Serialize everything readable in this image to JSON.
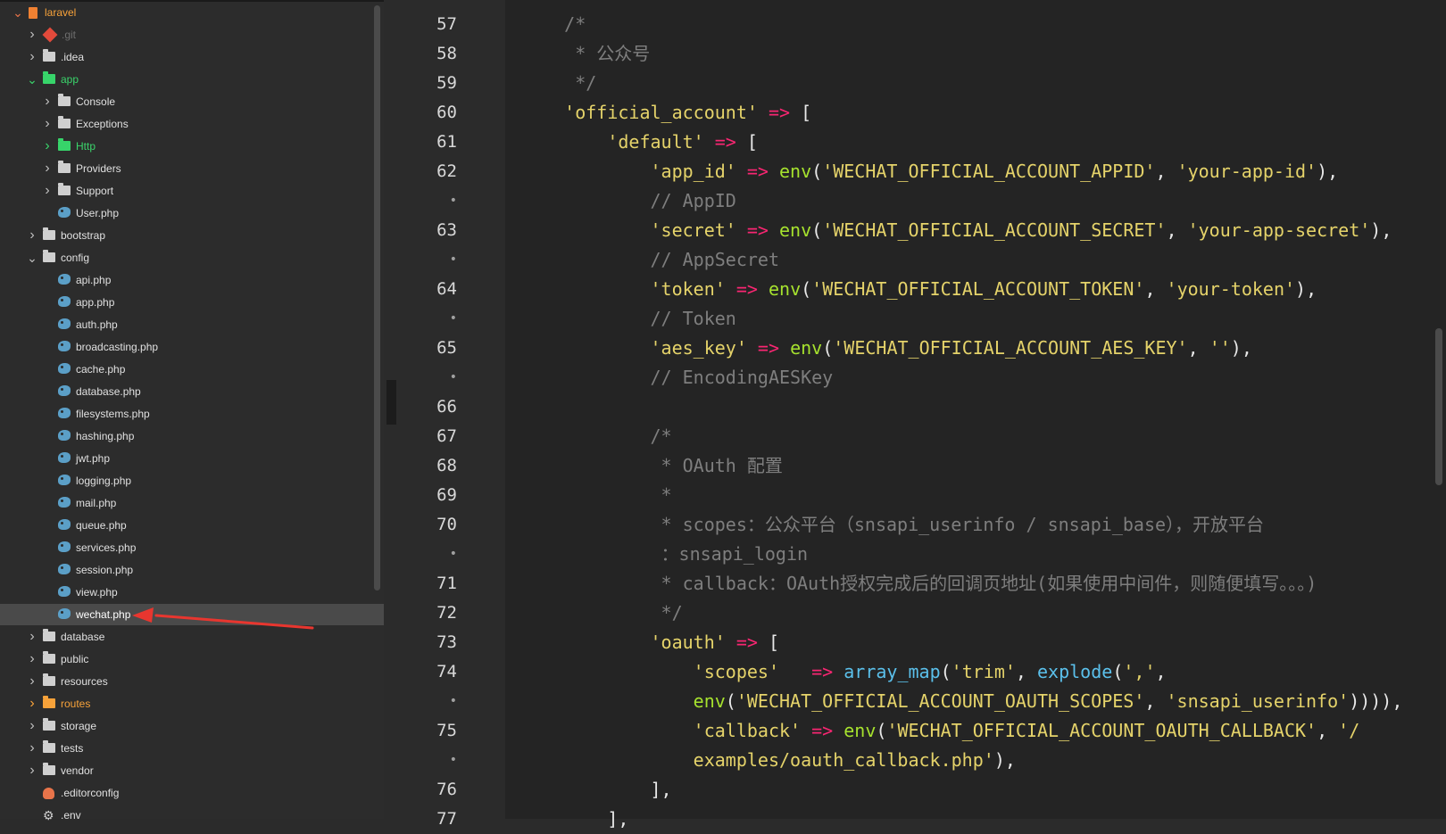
{
  "tree": [
    {
      "label": "laravel",
      "level": 0,
      "arrow": "open-red",
      "icon": "repo",
      "color": "orange"
    },
    {
      "label": ".git",
      "level": 1,
      "arrow": "closed",
      "icon": "git",
      "color": "gray"
    },
    {
      "label": ".idea",
      "level": 1,
      "arrow": "closed",
      "icon": "folder",
      "color": "normal"
    },
    {
      "label": "app",
      "level": 1,
      "arrow": "open",
      "icon": "folder-green",
      "color": "green"
    },
    {
      "label": "Console",
      "level": 2,
      "arrow": "closed",
      "icon": "folder",
      "color": "normal"
    },
    {
      "label": "Exceptions",
      "level": 2,
      "arrow": "closed",
      "icon": "folder",
      "color": "normal"
    },
    {
      "label": "Http",
      "level": 2,
      "arrow": "closed-green",
      "icon": "folder-green",
      "color": "green"
    },
    {
      "label": "Providers",
      "level": 2,
      "arrow": "closed",
      "icon": "folder",
      "color": "normal"
    },
    {
      "label": "Support",
      "level": 2,
      "arrow": "closed",
      "icon": "folder",
      "color": "normal"
    },
    {
      "label": "User.php",
      "level": 2,
      "arrow": "none",
      "icon": "php",
      "color": "normal"
    },
    {
      "label": "bootstrap",
      "level": 1,
      "arrow": "closed",
      "icon": "folder",
      "color": "normal"
    },
    {
      "label": "config",
      "level": 1,
      "arrow": "open-plain",
      "icon": "folder",
      "color": "normal"
    },
    {
      "label": "api.php",
      "level": 2,
      "arrow": "none",
      "icon": "php",
      "color": "normal"
    },
    {
      "label": "app.php",
      "level": 2,
      "arrow": "none",
      "icon": "php",
      "color": "normal"
    },
    {
      "label": "auth.php",
      "level": 2,
      "arrow": "none",
      "icon": "php",
      "color": "normal"
    },
    {
      "label": "broadcasting.php",
      "level": 2,
      "arrow": "none",
      "icon": "php",
      "color": "normal"
    },
    {
      "label": "cache.php",
      "level": 2,
      "arrow": "none",
      "icon": "php",
      "color": "normal"
    },
    {
      "label": "database.php",
      "level": 2,
      "arrow": "none",
      "icon": "php",
      "color": "normal"
    },
    {
      "label": "filesystems.php",
      "level": 2,
      "arrow": "none",
      "icon": "php",
      "color": "normal"
    },
    {
      "label": "hashing.php",
      "level": 2,
      "arrow": "none",
      "icon": "php",
      "color": "normal"
    },
    {
      "label": "jwt.php",
      "level": 2,
      "arrow": "none",
      "icon": "php",
      "color": "normal"
    },
    {
      "label": "logging.php",
      "level": 2,
      "arrow": "none",
      "icon": "php",
      "color": "normal"
    },
    {
      "label": "mail.php",
      "level": 2,
      "arrow": "none",
      "icon": "php",
      "color": "normal"
    },
    {
      "label": "queue.php",
      "level": 2,
      "arrow": "none",
      "icon": "php",
      "color": "normal"
    },
    {
      "label": "services.php",
      "level": 2,
      "arrow": "none",
      "icon": "php",
      "color": "normal"
    },
    {
      "label": "session.php",
      "level": 2,
      "arrow": "none",
      "icon": "php",
      "color": "normal"
    },
    {
      "label": "view.php",
      "level": 2,
      "arrow": "none",
      "icon": "php",
      "color": "normal"
    },
    {
      "label": "wechat.php",
      "level": 2,
      "arrow": "none",
      "icon": "php",
      "color": "white",
      "selected": true
    },
    {
      "label": "database",
      "level": 1,
      "arrow": "closed",
      "icon": "folder",
      "color": "normal"
    },
    {
      "label": "public",
      "level": 1,
      "arrow": "closed",
      "icon": "folder",
      "color": "normal"
    },
    {
      "label": "resources",
      "level": 1,
      "arrow": "closed",
      "icon": "folder",
      "color": "normal"
    },
    {
      "label": "routes",
      "level": 1,
      "arrow": "closed-orange",
      "icon": "folder-orange",
      "color": "orange"
    },
    {
      "label": "storage",
      "level": 1,
      "arrow": "closed",
      "icon": "folder",
      "color": "normal"
    },
    {
      "label": "tests",
      "level": 1,
      "arrow": "closed",
      "icon": "folder",
      "color": "normal"
    },
    {
      "label": "vendor",
      "level": 1,
      "arrow": "closed",
      "icon": "folder",
      "color": "normal"
    },
    {
      "label": ".editorconfig",
      "level": 1,
      "arrow": "none",
      "icon": "editorconfig",
      "color": "normal"
    },
    {
      "label": ".env",
      "level": 1,
      "arrow": "none",
      "icon": "gear",
      "color": "normal"
    }
  ],
  "gutter": [
    "57",
    "58",
    "59",
    "60",
    "61",
    "62",
    "•",
    "63",
    "•",
    "64",
    "•",
    "65",
    "•",
    "66",
    "67",
    "68",
    "69",
    "70",
    "•",
    "71",
    "72",
    "73",
    "74",
    "•",
    "75",
    "•",
    "76",
    "77"
  ],
  "code_lines": [
    [
      [
        "c",
        "    /*"
      ]
    ],
    [
      [
        "c",
        "     * 公众号"
      ]
    ],
    [
      [
        "c",
        "     */"
      ]
    ],
    [
      [
        "p",
        "    "
      ],
      [
        "s",
        "'official_account'"
      ],
      [
        "p",
        " "
      ],
      [
        "o",
        "=>"
      ],
      [
        "p",
        " ["
      ]
    ],
    [
      [
        "p",
        "        "
      ],
      [
        "s",
        "'default'"
      ],
      [
        "p",
        " "
      ],
      [
        "o",
        "=>"
      ],
      [
        "p",
        " ["
      ]
    ],
    [
      [
        "p",
        "            "
      ],
      [
        "s",
        "'app_id'"
      ],
      [
        "p",
        " "
      ],
      [
        "o",
        "=>"
      ],
      [
        "p",
        " "
      ],
      [
        "f",
        "env"
      ],
      [
        "p",
        "("
      ],
      [
        "s",
        "'WECHAT_OFFICIAL_ACCOUNT_APPID'"
      ],
      [
        "p",
        ", "
      ],
      [
        "s",
        "'your-app-id'"
      ],
      [
        "p",
        "),"
      ]
    ],
    [
      [
        "c",
        "            // AppID"
      ]
    ],
    [
      [
        "p",
        "            "
      ],
      [
        "s",
        "'secret'"
      ],
      [
        "p",
        " "
      ],
      [
        "o",
        "=>"
      ],
      [
        "p",
        " "
      ],
      [
        "f",
        "env"
      ],
      [
        "p",
        "("
      ],
      [
        "s",
        "'WECHAT_OFFICIAL_ACCOUNT_SECRET'"
      ],
      [
        "p",
        ", "
      ],
      [
        "s",
        "'your-app-secret'"
      ],
      [
        "p",
        "),"
      ]
    ],
    [
      [
        "c",
        "            // AppSecret"
      ]
    ],
    [
      [
        "p",
        "            "
      ],
      [
        "s",
        "'token'"
      ],
      [
        "p",
        " "
      ],
      [
        "o",
        "=>"
      ],
      [
        "p",
        " "
      ],
      [
        "f",
        "env"
      ],
      [
        "p",
        "("
      ],
      [
        "s",
        "'WECHAT_OFFICIAL_ACCOUNT_TOKEN'"
      ],
      [
        "p",
        ", "
      ],
      [
        "s",
        "'your-token'"
      ],
      [
        "p",
        "),"
      ]
    ],
    [
      [
        "c",
        "            // Token"
      ]
    ],
    [
      [
        "p",
        "            "
      ],
      [
        "s",
        "'aes_key'"
      ],
      [
        "p",
        " "
      ],
      [
        "o",
        "=>"
      ],
      [
        "p",
        " "
      ],
      [
        "f",
        "env"
      ],
      [
        "p",
        "("
      ],
      [
        "s",
        "'WECHAT_OFFICIAL_ACCOUNT_AES_KEY'"
      ],
      [
        "p",
        ", "
      ],
      [
        "s",
        "''"
      ],
      [
        "p",
        "),"
      ]
    ],
    [
      [
        "c",
        "            // EncodingAESKey"
      ]
    ],
    [
      [
        "p",
        ""
      ]
    ],
    [
      [
        "c",
        "            /*"
      ]
    ],
    [
      [
        "c",
        "             * OAuth 配置"
      ]
    ],
    [
      [
        "c",
        "             *"
      ]
    ],
    [
      [
        "c",
        "             * scopes：公众平台（snsapi_userinfo / snsapi_base），开放平台"
      ]
    ],
    [
      [
        "c",
        "             ：snsapi_login"
      ]
    ],
    [
      [
        "c",
        "             * callback：OAuth授权完成后的回调页地址(如果使用中间件，则随便填写。。。)"
      ]
    ],
    [
      [
        "c",
        "             */"
      ]
    ],
    [
      [
        "p",
        "            "
      ],
      [
        "s",
        "'oauth'"
      ],
      [
        "p",
        " "
      ],
      [
        "o",
        "=>"
      ],
      [
        "p",
        " ["
      ]
    ],
    [
      [
        "p",
        "                "
      ],
      [
        "s",
        "'scopes'"
      ],
      [
        "p",
        "   "
      ],
      [
        "o",
        "=>"
      ],
      [
        "p",
        " "
      ],
      [
        "b",
        "array_map"
      ],
      [
        "p",
        "("
      ],
      [
        "s",
        "'trim'"
      ],
      [
        "p",
        ", "
      ],
      [
        "b",
        "explode"
      ],
      [
        "p",
        "("
      ],
      [
        "s",
        "','"
      ],
      [
        "p",
        ","
      ]
    ],
    [
      [
        "p",
        "                "
      ],
      [
        "f",
        "env"
      ],
      [
        "p",
        "("
      ],
      [
        "s",
        "'WECHAT_OFFICIAL_ACCOUNT_OAUTH_SCOPES'"
      ],
      [
        "p",
        ", "
      ],
      [
        "s",
        "'snsapi_userinfo'"
      ],
      [
        "p",
        ")))),"
      ]
    ],
    [
      [
        "p",
        "                "
      ],
      [
        "s",
        "'callback'"
      ],
      [
        "p",
        " "
      ],
      [
        "o",
        "=>"
      ],
      [
        "p",
        " "
      ],
      [
        "f",
        "env"
      ],
      [
        "p",
        "("
      ],
      [
        "s",
        "'WECHAT_OFFICIAL_ACCOUNT_OAUTH_CALLBACK'"
      ],
      [
        "p",
        ", "
      ],
      [
        "s",
        "'/"
      ]
    ],
    [
      [
        "s",
        "                examples/oauth_callback.php'"
      ],
      [
        "p",
        "),"
      ]
    ],
    [
      [
        "p",
        "            ],"
      ]
    ],
    [
      [
        "p",
        "        ],"
      ]
    ]
  ],
  "collapse_icon": "chevron-left-icon"
}
